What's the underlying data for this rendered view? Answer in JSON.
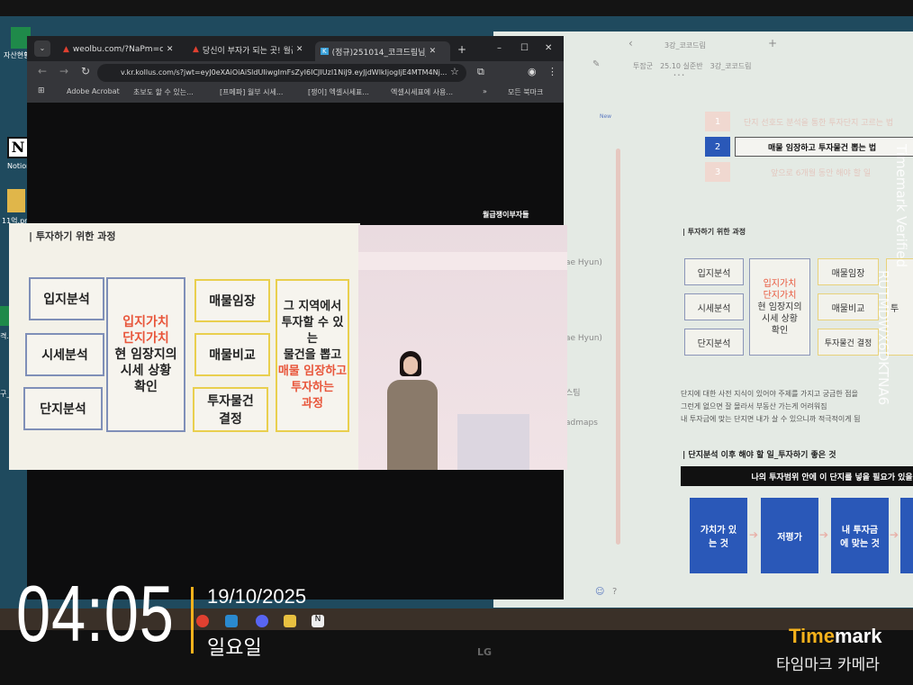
{
  "desktop": {
    "icons": [
      {
        "label": "자산현황"
      },
      {
        "label": "Notion"
      },
      {
        "label": "11억.pr"
      },
      {
        "label": "격.xl"
      },
      {
        "label": "구_"
      }
    ]
  },
  "browser": {
    "tabs": [
      {
        "label": "weolbu.com/?NaPm=ct%3D"
      },
      {
        "label": "당신이 부자가 되는 곳! 월급"
      },
      {
        "label": "(정규)251014_코크드림님_럼"
      }
    ],
    "new_tab": "+",
    "url": "v.kr.kollus.com/s?jwt=eyJ0eXAiOiAiSldUIiwgImFsZyI6ICJIUzI1NiJ9.eyJjdWlkIjogIjE4MTM4Nj...",
    "bookmarks": [
      "Adobe Acrobat",
      "초보도 할 수 있는...",
      "[프메파] 월부 시세...",
      "[쟁이] 엑셀시세표...",
      "엑셀시세표에 사용..."
    ],
    "bookmarks_more": "»",
    "all_bookmarks": "모든 북마크"
  },
  "video": {
    "watermark": "월급쟁이부자들",
    "slide_title": "| 투자하기 위한 과정",
    "col1": [
      "입지분석",
      "시세분석",
      "단지분석"
    ],
    "col2_red": [
      "입지가치",
      "단지가치"
    ],
    "col2_black": [
      "현 임장지의",
      "시세 상황",
      "확인"
    ],
    "col3": [
      "매물임장",
      "매물비교",
      "투자물건 결정"
    ],
    "col4_black": [
      "그 지역에서",
      "투자할 수 있는",
      "물건을 뽑고"
    ],
    "col4_red": [
      "매물 임장하고",
      "투자하는"
    ],
    "col4_end": "과정"
  },
  "notion": {
    "tab_title": "3강_코코드림",
    "breadcrumb": [
      "투잡군",
      "25.10 실준반",
      "3강_코코드림"
    ],
    "breadcrumb_more": "• • •",
    "new_badge": "New",
    "sidebar_partial": [
      "ae Hyun)",
      "ae Hyun)",
      "스팀",
      "admaps"
    ],
    "toc": [
      {
        "num": "1",
        "label": "단지 선호도 분석을 통한 투자단지 고르는 법"
      },
      {
        "num": "2",
        "label": "매물 임장하고 투자물건 뽑는 법"
      },
      {
        "num": "3",
        "label": "앞으로 6개월 동안 해야 할 일"
      }
    ],
    "section1_title": "| 투자하기 위한 과정",
    "diagram": {
      "col1": [
        "입지분석",
        "시세분석",
        "단지분석"
      ],
      "col2_red": [
        "입지가치",
        "단지가치"
      ],
      "col2_black": [
        "현 임장지의",
        "시세 상황",
        "확인"
      ],
      "col3": [
        "매물임장",
        "매물비교",
        "투자물건 결정"
      ],
      "col4_partial": "투"
    },
    "notes": [
      "단지에 대한 사전 지식이 있어야 주제를 가지고 궁금한 점을",
      "그런게 없으면 잘 몰라서 부동산 가는게 어려워짐",
      "내 투자금에 맞는 단지면 내가 살 수 있으니까 적극적이게 됨"
    ],
    "section2_title": "| 단지분석 이후 해야 할 일_투자하기 좋은 것",
    "banner": "나의 투자범위 안에 이 단지를 넣을 필요가 있을까",
    "flow": [
      "가치가 있는 것",
      "저평가",
      "내 투자금에 맞는 것"
    ]
  },
  "monitor": {
    "brand": "LG"
  },
  "overlay": {
    "time": "04:05",
    "date": "19/10/2025",
    "weekday": "일요일",
    "brand_time": "Time",
    "brand_mark": "mark",
    "brand_sub": "타임마크 카메라",
    "verified": "Timemark Verified",
    "code": "RUTMDWX6DKTNA6"
  },
  "colors": {
    "accent": "#f5b21c",
    "notion_blue": "#2a58b8"
  }
}
